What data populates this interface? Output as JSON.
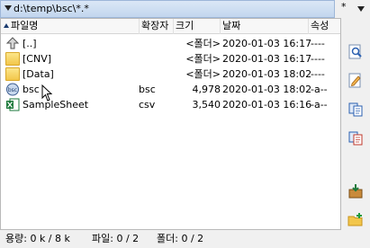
{
  "path": {
    "text": "d:\\temp\\bsc\\*.*"
  },
  "tools": {
    "filter_symbol": "*"
  },
  "columns": {
    "name": "파일명",
    "ext": "확장자",
    "size": "크기",
    "date": "날짜",
    "attr": "속성"
  },
  "rows": [
    {
      "name": "[..]",
      "ext": "",
      "size": "<폴더>",
      "date": "2020-01-03 16:17",
      "attr": "----",
      "icon": "parent-dir-icon"
    },
    {
      "name": "[CNV]",
      "ext": "",
      "size": "<폴더>",
      "date": "2020-01-03 16:17",
      "attr": "----",
      "icon": "folder-icon"
    },
    {
      "name": "[Data]",
      "ext": "",
      "size": "<폴더>",
      "date": "2020-01-03 18:02",
      "attr": "----",
      "icon": "folder-icon"
    },
    {
      "name": "bsc",
      "ext": "bsc",
      "size": "4,978",
      "date": "2020-01-03 18:02",
      "attr": "-a--",
      "icon": "bsc-file-icon"
    },
    {
      "name": "SampleSheet",
      "ext": "csv",
      "size": "3,540",
      "date": "2020-01-03 16:16",
      "attr": "-a--",
      "icon": "excel-file-icon"
    }
  ],
  "status": {
    "capacity": "용량: 0 k / 8 k",
    "files": "파일: 0 / 2",
    "folders": "폴더: 0 / 2"
  },
  "colors": {
    "accent": "#2a5fb0",
    "folder": "#f2c64b",
    "excel": "#1e7a3c"
  },
  "side_buttons": [
    "zoom-icon",
    "edit-file-icon",
    "copy-icon",
    "move-icon",
    "pack-icon",
    "new-folder-icon"
  ]
}
